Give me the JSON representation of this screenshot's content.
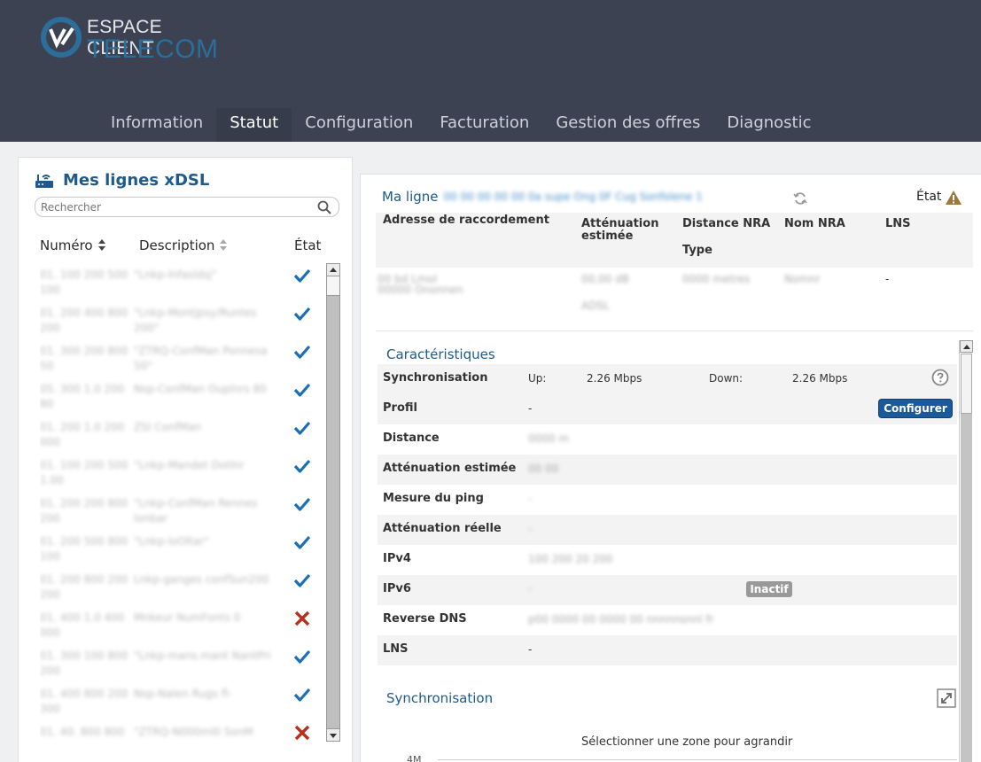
{
  "brand": {
    "line1": "ESPACE CLIENT",
    "line2": "TELECOM"
  },
  "nav": {
    "items": [
      {
        "label": "Information",
        "active": false
      },
      {
        "label": "Statut",
        "active": true
      },
      {
        "label": "Configuration",
        "active": false
      },
      {
        "label": "Facturation",
        "active": false
      },
      {
        "label": "Gestion des offres",
        "active": false
      },
      {
        "label": "Diagnostic",
        "active": false
      }
    ]
  },
  "lines_panel": {
    "title": "Mes lignes xDSL",
    "search_placeholder": "Rechercher",
    "headers": {
      "numero": "Numéro",
      "description": "Description",
      "etat": "État"
    },
    "rows": [
      {
        "numero": "01. 100 200 500 100",
        "description": "\"Lnkp-lnfasldsj\"",
        "state": "ok"
      },
      {
        "numero": "01. 200 400 800 200",
        "description": "\"Lnkp-Montjpsy/Runtes 200\"",
        "state": "ok"
      },
      {
        "numero": "01. 300 200 800 50",
        "description": "\"ZTRQ-ConfMan Ponnesa 50\"",
        "state": "ok"
      },
      {
        "numero": "05. 300 1.0 200 80",
        "description": "Nsp-ConfMan Ouplnrs 80",
        "state": "ok"
      },
      {
        "numero": "01. 200 1.0 200 000",
        "description": "ZSI ConfMan",
        "state": "ok"
      },
      {
        "numero": "01. 100 200 500 1.00",
        "description": "\"Lnkp-Mandet Dotlnr",
        "state": "ok"
      },
      {
        "numero": "01. 200 200 800 200",
        "description": "\"Lnkp-ConfMan Rennes lonbar",
        "state": "ok"
      },
      {
        "numero": "01. 200 500 800 100",
        "description": "\"Lnkp-loOltar\"",
        "state": "ok"
      },
      {
        "numero": "01. 200 800 200 200",
        "description": "Lnkp-ganges confSun200",
        "state": "ok"
      },
      {
        "numero": "01. 400 1.0 400 000",
        "description": "Mnkeur NumFonts 0",
        "state": "error"
      },
      {
        "numero": "01. 300 100 800 200",
        "description": "\"Lnkp-mans.mant NantPri",
        "state": "ok"
      },
      {
        "numero": "01. 400 800 200 300",
        "description": "Nsp-Nalen Rugs fl-",
        "state": "ok"
      },
      {
        "numero": "01. 40. 800 800",
        "description": "\"ZTRQ-N000ml0 SonM",
        "state": "error"
      }
    ]
  },
  "detail": {
    "title": "Ma ligne",
    "line_id": "00 00 00 00 00 0a supe Ong 0F Cug Sonfolene 1",
    "etat_label": "État",
    "table": {
      "headers": {
        "adresse": "Adresse de raccordement",
        "attenuation": "Atténuation estimée",
        "distance": "Distance NRA",
        "type": "Type",
        "nom_nra": "Nom NRA",
        "lns": "LNS"
      },
      "values": {
        "adresse_line1": "00 bd Lmol",
        "adresse_line2": "00000 Ononnen",
        "attenuation": "00,00 dB",
        "distance": "0000 metres",
        "type": "ADSL",
        "nom_nra": "Nomnr",
        "lns": "-"
      }
    },
    "caracteristiques": {
      "title": "Caractéristiques",
      "synchronisation_label": "Synchronisation",
      "up_label": "Up:",
      "up_value": "2.26 Mbps",
      "down_label": "Down:",
      "down_value": "2.26 Mbps",
      "profil_label": "Profil",
      "profil_value": "-",
      "configure_button": "Configurer",
      "distance_label": "Distance",
      "distance_value": "0000 m",
      "att_est_label": "Atténuation estimée",
      "att_est_value": "00 00",
      "ping_label": "Mesure du ping",
      "ping_value": "-",
      "att_reelle_label": "Atténuation réelle",
      "att_reelle_value": "-",
      "ipv4_label": "IPv4",
      "ipv4_value": "100 200 20 200",
      "ipv6_label": "IPv6",
      "ipv6_value": "-",
      "ipv6_badge": "Inactif",
      "rdns_label": "Reverse DNS",
      "rdns_value": "p00 0000 00 0000 00 nnnnnsnnl fr",
      "lns_label": "LNS",
      "lns_value": "-"
    },
    "sync_chart": {
      "title": "Synchronisation",
      "hint": "Sélectionner une zone pour agrandir",
      "y_label": "4M"
    }
  },
  "colors": {
    "header_bg": "#3c4252",
    "brand_blue": "#1e5a8c",
    "ok_check": "#1a6fb5",
    "error_x": "#b5331e",
    "warning": "#a0763a"
  }
}
